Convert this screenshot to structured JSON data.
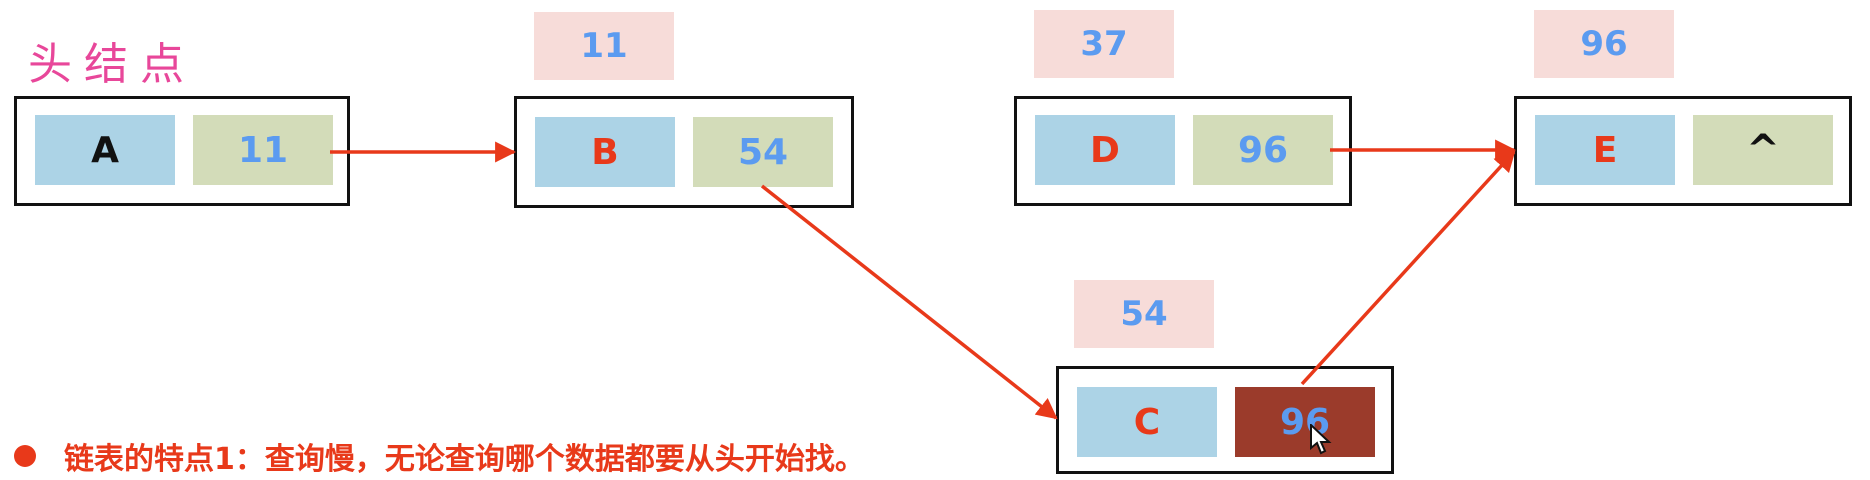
{
  "head_label": "头结点",
  "nodes": {
    "A": {
      "data": "A",
      "next": "11"
    },
    "B": {
      "address": "11",
      "data": "B",
      "next": "54"
    },
    "D": {
      "address": "37",
      "data": "D",
      "next": "96"
    },
    "E": {
      "address": "96",
      "data": "E",
      "next": "^"
    },
    "C": {
      "address": "54",
      "data": "C",
      "next": "96"
    }
  },
  "caption": "链表的特点1：查询慢，无论查询哪个数据都要从头开始找。",
  "colors": {
    "data_cell": "#acd3e6",
    "pointer_cell": "#d3dcb9",
    "address_box": "#f7dcd9",
    "highlight_cell": "#9b3b2b",
    "arrow": "#e8391a",
    "head_label": "#e8479a",
    "number_text": "#5b9bf0",
    "letter_text": "#e8391a"
  }
}
